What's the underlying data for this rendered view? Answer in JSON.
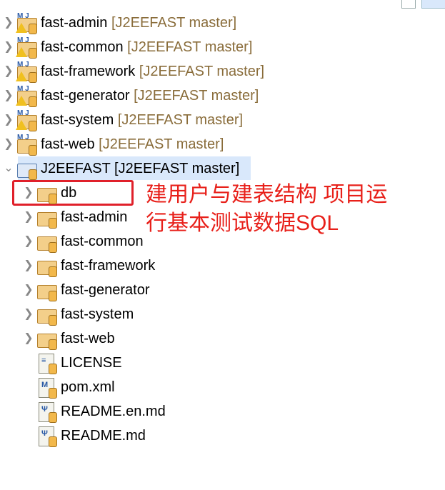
{
  "projects": [
    {
      "name": "fast-admin",
      "repo": "[J2EEFAST master]",
      "warning": true
    },
    {
      "name": "fast-common",
      "repo": "[J2EEFAST master]",
      "warning": true
    },
    {
      "name": "fast-framework",
      "repo": "[J2EEFAST master]",
      "warning": true
    },
    {
      "name": "fast-generator",
      "repo": "[J2EEFAST master]",
      "warning": true
    },
    {
      "name": "fast-system",
      "repo": "[J2EEFAST master]",
      "warning": true
    },
    {
      "name": "fast-web",
      "repo": "[J2EEFAST master]",
      "warning": false
    }
  ],
  "root": {
    "label": "J2EEFAST [J2EEFAST master]",
    "expanded": true
  },
  "children": [
    {
      "name": "db",
      "type": "folder"
    },
    {
      "name": "fast-admin",
      "type": "folder"
    },
    {
      "name": "fast-common",
      "type": "folder"
    },
    {
      "name": "fast-framework",
      "type": "folder"
    },
    {
      "name": "fast-generator",
      "type": "folder"
    },
    {
      "name": "fast-system",
      "type": "folder"
    },
    {
      "name": "fast-web",
      "type": "folder"
    },
    {
      "name": "LICENSE",
      "type": "text-file"
    },
    {
      "name": "pom.xml",
      "type": "maven-file"
    },
    {
      "name": "README.en.md",
      "type": "markdown-file"
    },
    {
      "name": "README.md",
      "type": "markdown-file"
    }
  ],
  "annotation": {
    "line1": "建用户与建表结构 项目运",
    "line2": "行基本测试数据SQL",
    "color": "#e8201a"
  }
}
